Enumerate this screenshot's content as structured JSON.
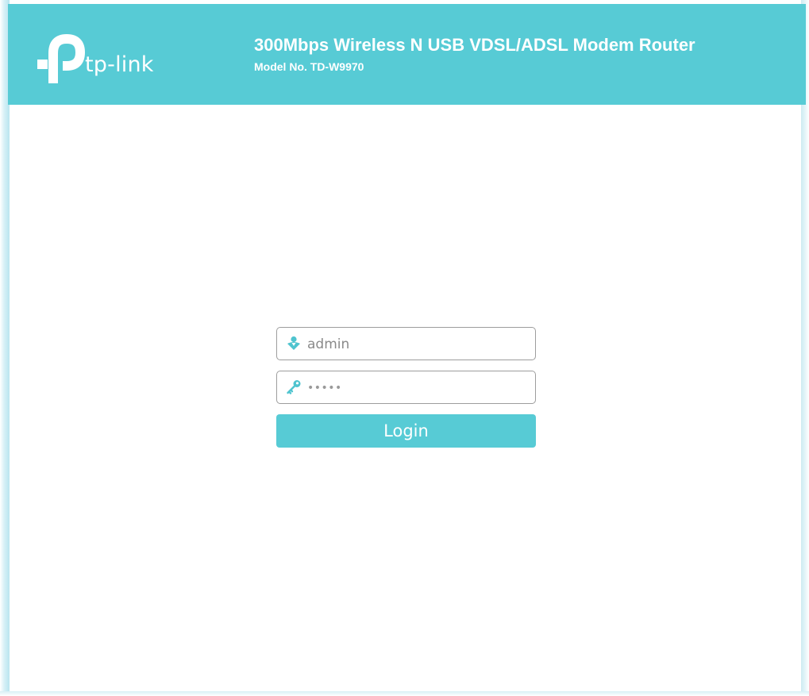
{
  "header": {
    "brand": "tp-link",
    "title": "300Mbps Wireless N USB VDSL/ADSL Modem Router",
    "model": "Model No. TD-W9970",
    "background_color": "#57cbd5"
  },
  "login_form": {
    "username": {
      "value": "admin",
      "icon": "user-icon"
    },
    "password": {
      "masked_value": "•••••",
      "icon": "key-icon"
    },
    "login_button": {
      "label": "Login",
      "color": "#57cbd5"
    }
  },
  "colors": {
    "accent": "#57cbd5",
    "icon": "#4fc4cf"
  }
}
